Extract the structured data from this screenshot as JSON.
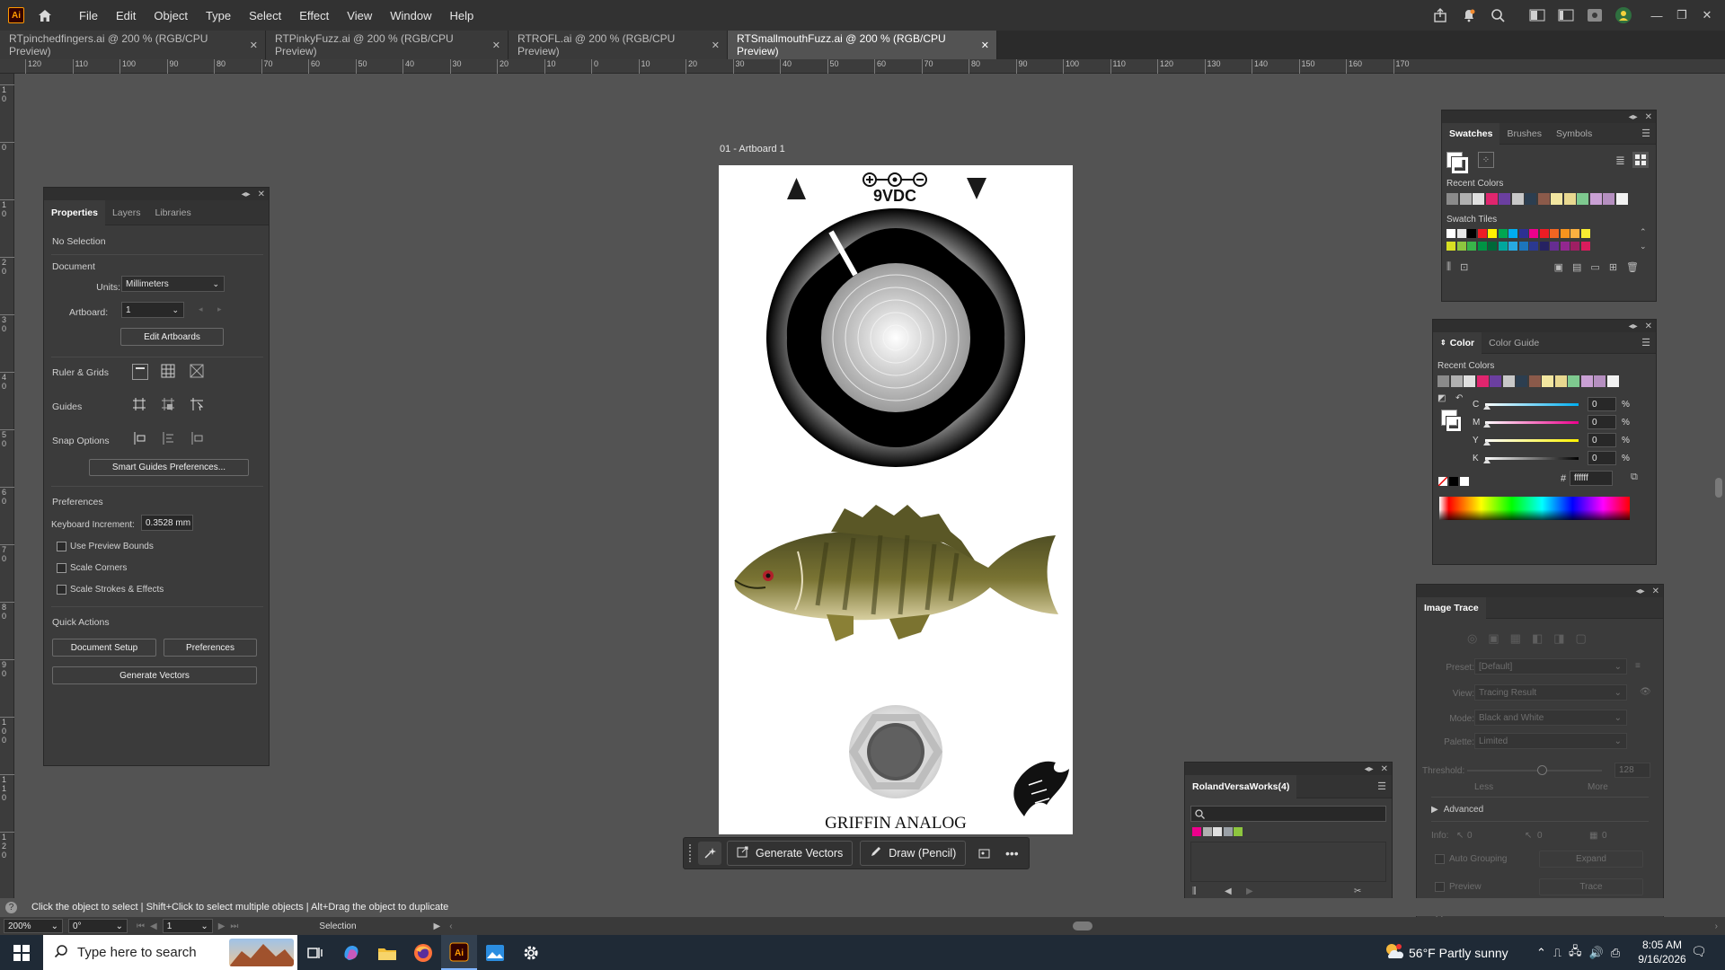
{
  "menubar": {
    "app_logo": "Ai",
    "items": [
      "File",
      "Edit",
      "Object",
      "Type",
      "Select",
      "Effect",
      "View",
      "Window",
      "Help"
    ]
  },
  "tabs": [
    {
      "label": "RTpinchedfingers.ai @ 200 % (RGB/CPU Preview)",
      "active": false
    },
    {
      "label": "RTPinkyFuzz.ai @ 200 % (RGB/CPU Preview)",
      "active": false
    },
    {
      "label": "RTROFL.ai @ 200 % (RGB/CPU Preview)",
      "active": false
    },
    {
      "label": "RTSmallmouthFuzz.ai @ 200 % (RGB/CPU Preview)",
      "active": true
    }
  ],
  "ruler_h": [
    "120",
    "110",
    "100",
    "90",
    "80",
    "70",
    "60",
    "50",
    "40",
    "30",
    "20",
    "10",
    "0",
    "10",
    "20",
    "30",
    "40",
    "50",
    "60",
    "70",
    "80",
    "90",
    "100",
    "110",
    "120",
    "130",
    "140",
    "150",
    "160",
    "170"
  ],
  "ruler_v": [
    "1 0",
    "0",
    "1 0",
    "2 0",
    "3 0",
    "4 0",
    "5 0",
    "6 0",
    "7 0",
    "8 0",
    "9 0",
    "1 0 0",
    "1 1 0",
    "1 2 0"
  ],
  "artboard": {
    "label": "01 - Artboard 1",
    "power_label": "9VDC",
    "brand": "GRIFFIN ANALOG"
  },
  "properties": {
    "tabs": [
      "Properties",
      "Layers",
      "Libraries"
    ],
    "selection": "No Selection",
    "document_label": "Document",
    "units_label": "Units:",
    "units_value": "Millimeters",
    "artboard_label": "Artboard:",
    "artboard_value": "1",
    "edit_artboards": "Edit Artboards",
    "ruler_grids": "Ruler & Grids",
    "guides": "Guides",
    "snap_options": "Snap Options",
    "smart_guides_btn": "Smart Guides Preferences...",
    "preferences_label": "Preferences",
    "keyboard_increment_label": "Keyboard Increment:",
    "keyboard_increment_value": "0.3528 mm",
    "use_preview_bounds": "Use Preview Bounds",
    "scale_corners": "Scale Corners",
    "scale_strokes": "Scale Strokes & Effects",
    "quick_actions": "Quick Actions",
    "document_setup": "Document Setup",
    "preferences_btn": "Preferences",
    "generate_vectors": "Generate Vectors"
  },
  "swatches": {
    "tabs": [
      "Swatches",
      "Brushes",
      "Symbols"
    ],
    "recent_colors_label": "Recent Colors",
    "swatch_tiles_label": "Swatch Tiles",
    "recent": [
      "#8a8a8a",
      "#b0b0b0",
      "#e0e0e0",
      "#e0256e",
      "#6b3fa0",
      "#c8c8c8",
      "#2c3e50",
      "#8b5a4a",
      "#f2e6a0",
      "#e8d890",
      "#7ec98f",
      "#c9a0d4",
      "#b58fc0",
      "#f2f2f2"
    ],
    "tiles_row1": [
      "#ffffff",
      "#e6e6e6",
      "#000000",
      "#ee1c25",
      "#fff200",
      "#00a651",
      "#00aeef",
      "#2e3192",
      "#ec008c",
      "#ed1c24",
      "#f26522",
      "#f7941d",
      "#fbb040",
      "#f9ed32"
    ],
    "tiles_row2": [
      "#d7df23",
      "#8dc63f",
      "#39b54a",
      "#009444",
      "#006838",
      "#00a79d",
      "#27aae1",
      "#1c75bc",
      "#2b3990",
      "#262262",
      "#662d91",
      "#92278f",
      "#9e1f63",
      "#da1c5c"
    ]
  },
  "color_panel": {
    "tabs": [
      "Color",
      "Color Guide"
    ],
    "recent_colors_label": "Recent Colors",
    "channels": [
      {
        "label": "C",
        "value": "0",
        "color": "#00aeef"
      },
      {
        "label": "M",
        "value": "0",
        "color": "#ec008c"
      },
      {
        "label": "Y",
        "value": "0",
        "color": "#fff200"
      },
      {
        "label": "K",
        "value": "0",
        "color": "#000000"
      }
    ],
    "percent": "%",
    "hex_label": "#",
    "hex_value": "ffffff"
  },
  "image_trace": {
    "title": "Image Trace",
    "preset_label": "Preset:",
    "preset_value": "[Default]",
    "view_label": "View:",
    "view_value": "Tracing Result",
    "mode_label": "Mode:",
    "mode_value": "Black and White",
    "palette_label": "Palette:",
    "palette_value": "Limited",
    "threshold_label": "Threshold:",
    "threshold_value": "128",
    "less": "Less",
    "more": "More",
    "advanced": "Advanced",
    "info_label": "Info:",
    "info_vals": [
      "0",
      "0",
      "0"
    ],
    "auto_grouping": "Auto Grouping",
    "expand": "Expand",
    "preview": "Preview",
    "trace": "Trace"
  },
  "roland": {
    "title": "RolandVersaWorks(4)",
    "swatches": [
      "#ec008c",
      "#b0b0b0",
      "#e0e0e0",
      "#9aa0a6",
      "#8dc63f"
    ]
  },
  "context_bar": {
    "generate_vectors": "Generate Vectors",
    "draw_pencil": "Draw (Pencil)"
  },
  "status": {
    "hint": "Click the object to select  |  Shift+Click to select multiple objects  |  Alt+Drag the object to duplicate",
    "zoom": "200%",
    "rotation": "0°",
    "artboard_nav": "1",
    "tool": "Selection"
  },
  "taskbar": {
    "search_placeholder": "Type here to search",
    "weather": "56°F  Partly sunny",
    "time": "8:05 AM",
    "date": "9/16/2026"
  }
}
